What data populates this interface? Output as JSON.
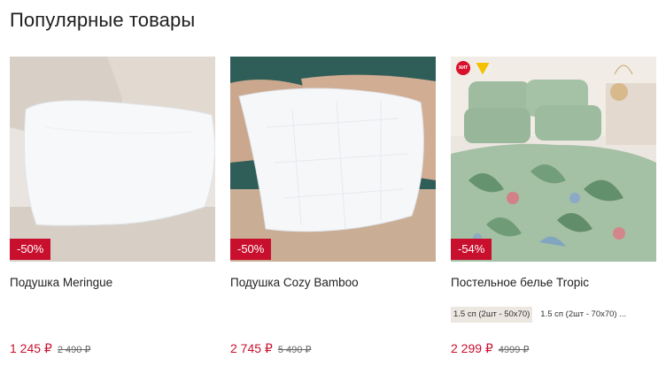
{
  "page": {
    "title": "Популярные товары"
  },
  "products": [
    {
      "name": "Подушка Meringue",
      "discount": "-50%",
      "price_now": "1 245 ₽",
      "price_old": "2 490 ₽",
      "image_icon": "pillow-photo"
    },
    {
      "name": "Подушка Cozy Bamboo",
      "discount": "-50%",
      "price_now": "2 745 ₽",
      "price_old": "5 490 ₽",
      "image_icon": "pillow-photo"
    },
    {
      "name": "Постельное белье Tropic",
      "discount": "-54%",
      "price_now": "2 299 ₽",
      "price_old": "4999 ₽",
      "image_icon": "bedding-photo",
      "badge_hit": "ХИТ",
      "variants": [
        "1.5 сп (2шт - 50x70)",
        "1.5 сп (2шт - 70x70) ..."
      ]
    }
  ],
  "colors": {
    "accent": "#c8102e"
  }
}
